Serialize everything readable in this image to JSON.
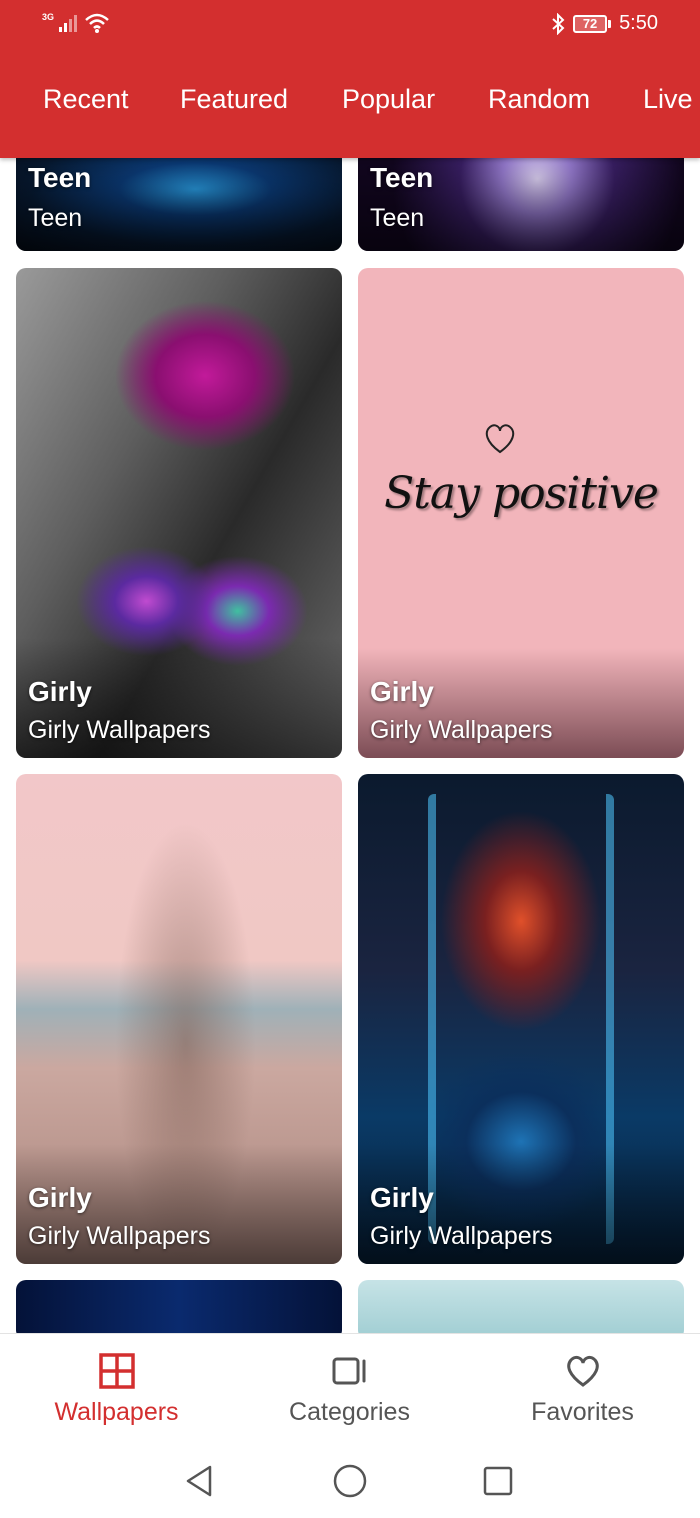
{
  "status_bar": {
    "network": "3G",
    "battery": "72",
    "time": "5:50"
  },
  "tabs": [
    "Recent",
    "Featured",
    "Popular",
    "Random",
    "Live"
  ],
  "cards": [
    {
      "title": "Teen",
      "subtitle": "Teen"
    },
    {
      "title": "Teen",
      "subtitle": "Teen"
    },
    {
      "title": "Girly",
      "subtitle": "Girly Wallpapers"
    },
    {
      "title": "Girly",
      "subtitle": "Girly Wallpapers"
    },
    {
      "title": "Girly",
      "subtitle": "Girly Wallpapers"
    },
    {
      "title": "Girly",
      "subtitle": "Girly Wallpapers"
    }
  ],
  "image_text": {
    "stay_positive": "Stay positive"
  },
  "bottom_nav": {
    "items": [
      {
        "label": "Wallpapers",
        "icon": "grid-icon",
        "active": true
      },
      {
        "label": "Categories",
        "icon": "categories-icon",
        "active": false
      },
      {
        "label": "Favorites",
        "icon": "heart-icon",
        "active": false
      }
    ]
  },
  "colors": {
    "primary": "#d32f2f",
    "inactive": "#555555"
  }
}
